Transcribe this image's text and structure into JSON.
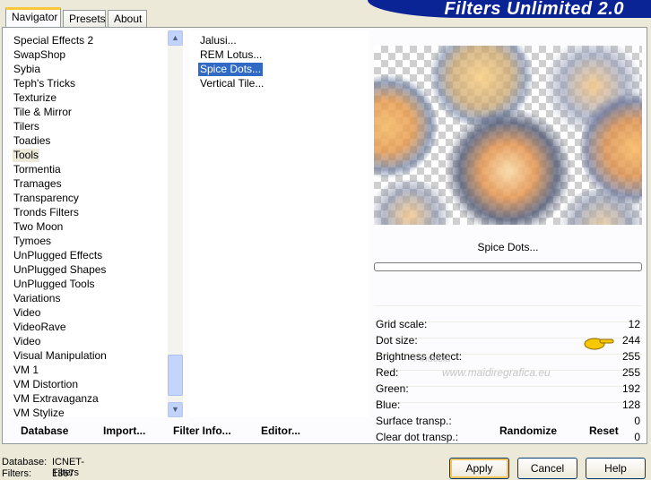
{
  "tabs": [
    "Navigator",
    "Presets",
    "About"
  ],
  "banner": "Filters Unlimited 2.0",
  "categories": [
    "Special Effects 2",
    "SwapShop",
    "Sybia",
    "Teph's Tricks",
    "Texturize",
    "Tile & Mirror",
    "Tilers",
    "Toadies",
    "Tools",
    "Tormentia",
    "Tramages",
    "Transparency",
    "Tronds Filters",
    "Two Moon",
    "Tymoes",
    "UnPlugged Effects",
    "UnPlugged Shapes",
    "UnPlugged Tools",
    "Variations",
    "Video",
    "VideoRave",
    "Video",
    "Visual Manipulation",
    "VM 1",
    "VM Distortion",
    "VM Extravaganza",
    "VM Stylize"
  ],
  "selected_category": "Tools",
  "filters": [
    "Jalusi...",
    "REM Lotus...",
    "Spice Dots...",
    "Vertical Tile..."
  ],
  "selected_filter": "Spice Dots...",
  "effect_name": "Spice Dots...",
  "params": [
    {
      "label": "Grid scale:",
      "value": "12"
    },
    {
      "label": "Dot size:",
      "value": "244"
    },
    {
      "label": "Brightness detect:",
      "value": "255"
    },
    {
      "label": "Red:",
      "value": "255"
    },
    {
      "label": "Green:",
      "value": "192"
    },
    {
      "label": "Blue:",
      "value": "128"
    },
    {
      "label": "Surface transp.:",
      "value": "0"
    },
    {
      "label": "Clear dot transp.:",
      "value": "0"
    }
  ],
  "bottom": {
    "database": "Database",
    "import": "Import...",
    "filter_info": "Filter Info...",
    "editor": "Editor...",
    "randomize": "Randomize",
    "reset": "Reset"
  },
  "status": {
    "database_label": "Database:",
    "database_value": "ICNET-Filters",
    "filters_label": "Filters:",
    "filters_value": "1367"
  },
  "buttons": {
    "apply": "Apply",
    "cancel": "Cancel",
    "help": "Help"
  },
  "watermark": {
    "line1": "Pinuccia",
    "line2": "www.maidiregrafica.eu"
  },
  "colors": {
    "banner": "#0a2496",
    "selection": "#316ac5",
    "tab_accent": "#ffc83c"
  }
}
